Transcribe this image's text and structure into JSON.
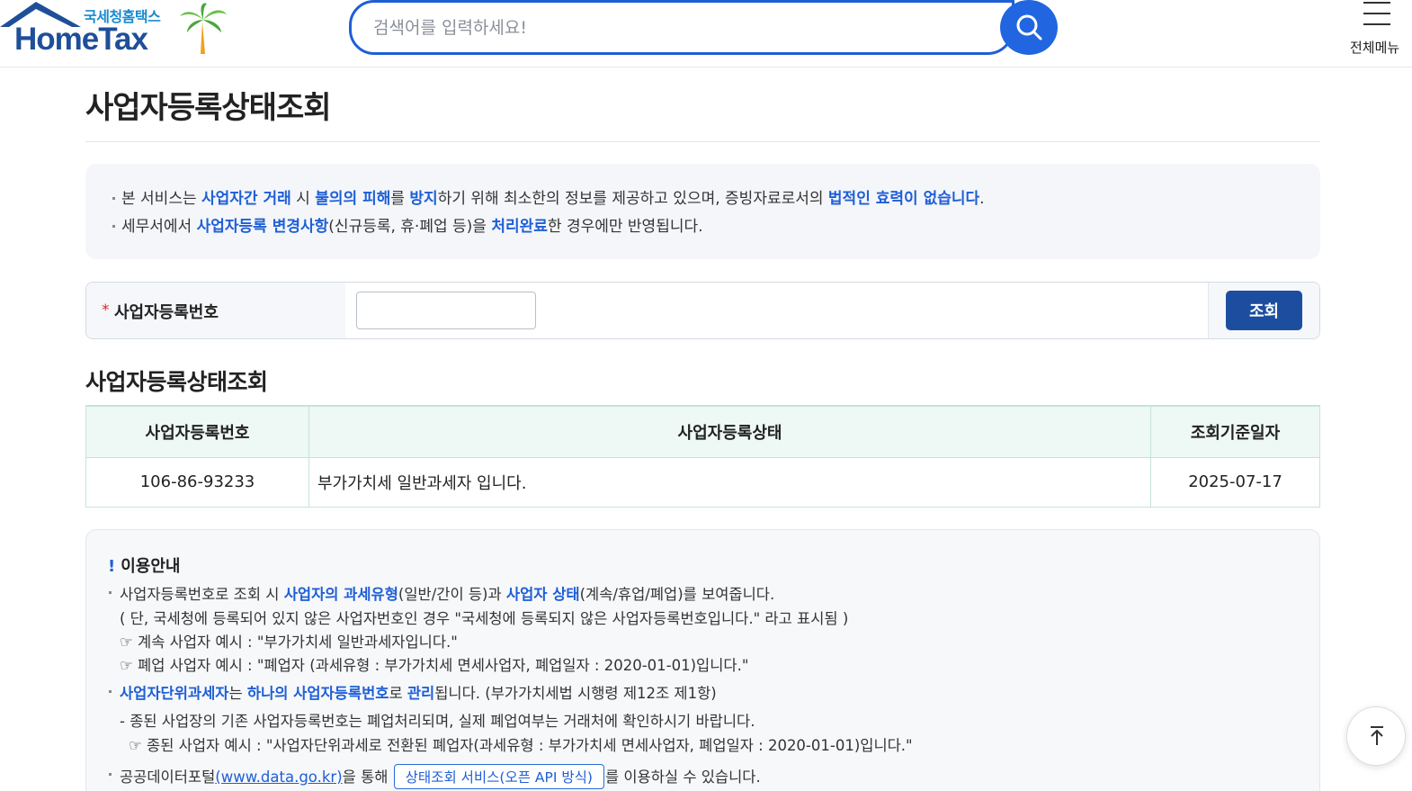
{
  "header": {
    "logo_sub": "국세청홈택스",
    "logo_main": "HomeTax",
    "search_placeholder": "검색어를 입력하세요!",
    "menu_label": "전체메뉴"
  },
  "page": {
    "title": "사업자등록상태조회"
  },
  "notice": {
    "line1": [
      {
        "t": "본 서비스는 ",
        "h": false
      },
      {
        "t": "사업자간 거래",
        "h": true
      },
      {
        "t": " 시 ",
        "h": false
      },
      {
        "t": "불의의 피해",
        "h": true
      },
      {
        "t": "를 ",
        "h": false
      },
      {
        "t": "방지",
        "h": true
      },
      {
        "t": "하기 위해 최소한의 정보를 제공하고 있으며, 증빙자료로서의 ",
        "h": false
      },
      {
        "t": "법적인 효력이 없습니다",
        "h": true
      },
      {
        "t": ".",
        "h": false
      }
    ],
    "line2": [
      {
        "t": "세무서에서 ",
        "h": false
      },
      {
        "t": "사업자등록 변경사항",
        "h": true
      },
      {
        "t": "(신규등록, 휴·폐업 등)을 ",
        "h": false
      },
      {
        "t": "처리완료",
        "h": true
      },
      {
        "t": "한 경우에만 반영됩니다.",
        "h": false
      }
    ]
  },
  "form": {
    "required_mark": "*",
    "label": "사업자등록번호",
    "input_value": "",
    "query_button": "조회"
  },
  "result": {
    "section_title": "사업자등록상태조회",
    "headers": [
      "사업자등록번호",
      "사업자등록상태",
      "조회기준일자"
    ],
    "rows": [
      [
        "106-86-93233",
        "부가가치세 일반과세자 입니다.",
        "2025-07-17"
      ]
    ]
  },
  "guide": {
    "title_mark": "!",
    "title": "이용안내",
    "b1": [
      {
        "t": "사업자등록번호로 조회 시 ",
        "h": false
      },
      {
        "t": "사업자의 과세유형",
        "h": true
      },
      {
        "t": "(일반/간이 등)과 ",
        "h": false
      },
      {
        "t": "사업자 상태",
        "h": true
      },
      {
        "t": "(계속/휴업/폐업)를 보여줍니다.",
        "h": false
      }
    ],
    "b1_l2": "( 단, 국세청에 등록되어 있지 않은 사업자번호인 경우 \"국세청에 등록되지 않은 사업자등록번호입니다.\" 라고 표시됨 )",
    "b1_l3": "☞ 계속 사업자 예시 : \"부가가치세 일반과세자입니다.\"",
    "b1_l4": "☞ 폐업 사업자 예시 : \"폐업자 (과세유형 : 부가가치세 면세사업자, 폐업일자 : 2020-01-01)입니다.\"",
    "b2": [
      {
        "t": "사업자단위과세자",
        "h": true
      },
      {
        "t": "는 ",
        "h": false
      },
      {
        "t": "하나의 사업자등록번호",
        "h": true
      },
      {
        "t": "로 ",
        "h": false
      },
      {
        "t": "관리",
        "h": true
      },
      {
        "t": "됩니다. (부가가치세법 시행령 제12조 제1항)",
        "h": false
      }
    ],
    "b2_l2": "- 종된 사업장의 기존 사업자등록번호는 폐업처리되며, 실제 폐업여부는 거래처에 확인하시기 바랍니다.",
    "b2_l3": "☞ 종된 사업자 예시 : \"사업자단위과세로 전환된 폐업자(과세유형 : 부가가치세 면세사업자, 폐업일자 : 2020-01-01)입니다.\"",
    "b3_pre": "공공데이터포털",
    "b3_link": "(www.data.go.kr)",
    "b3_mid": "을 통해 ",
    "b3_button": "상태조회 서비스(오픈 API 방식)",
    "b3_post": "를 이용하실 수 있습니다."
  }
}
